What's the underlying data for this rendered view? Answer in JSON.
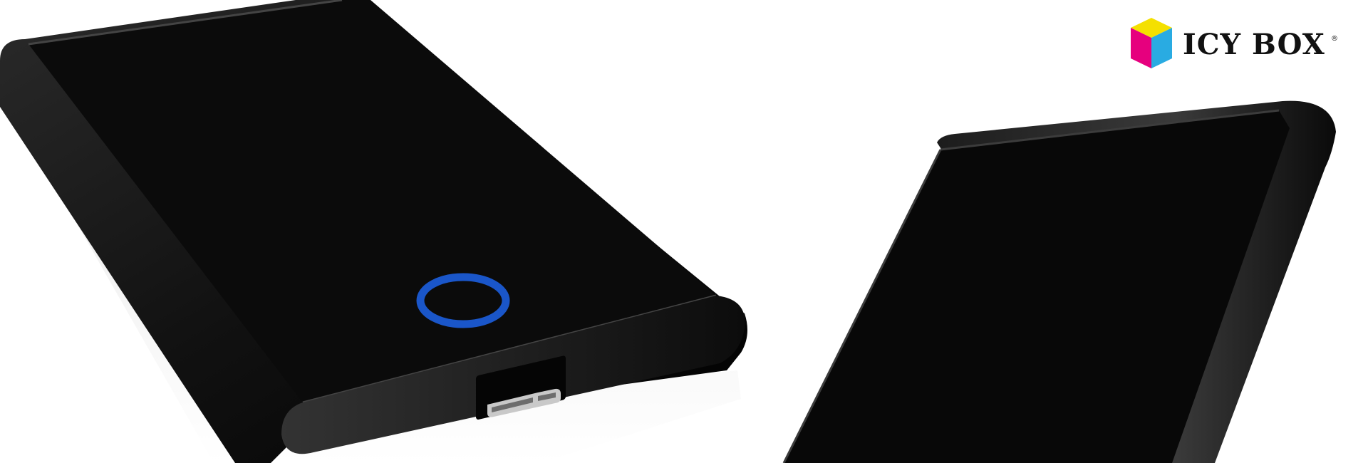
{
  "brand": {
    "name": "ICY BOX",
    "registered_mark": "®",
    "logo_colors": {
      "top": "#f4e000",
      "left": "#e6007e",
      "right": "#29abe2"
    }
  },
  "products": [
    {
      "name": "enclosure-front",
      "body_color": "#0a0a0a",
      "led_ring_color": "#1a56c9",
      "port": "micro-usb-3-port"
    },
    {
      "name": "enclosure-angled",
      "body_color": "#080808"
    }
  ],
  "background_color": "#ffffff"
}
